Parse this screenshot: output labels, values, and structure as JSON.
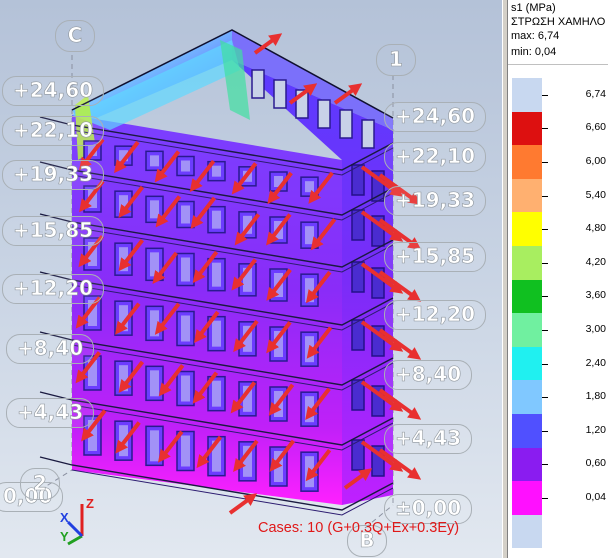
{
  "viewport": {
    "levels": [
      "+24,60",
      "+22,10",
      "+19,33",
      "+15,85",
      "+12,20",
      "+8,40",
      "+4,43",
      "±0,00"
    ],
    "left_levels": [
      "+24,60",
      "+22,10",
      "+19,33",
      "+15,85",
      "+12,20",
      "+8,40",
      "+4,43",
      "0,00"
    ],
    "grid_axes": {
      "c": "C",
      "one": "1",
      "two": "2",
      "b": "B"
    },
    "cases_label": "Cases: 10 (G+0.3Q+Ex+0.3Ey)",
    "triad": {
      "x": "X",
      "y": "Y",
      "z": "Z"
    }
  },
  "legend": {
    "quantity": "s1 (MPa)",
    "layer": "ΣΤΡΩΣΗ ΧΑΜΗΛΟ",
    "max_label": "max: 6,74",
    "min_label": "min: 0,04",
    "scale": [
      {
        "value": "6,74",
        "color": "#c8d8f0"
      },
      {
        "value": "6,60",
        "color": "#dd1010"
      },
      {
        "value": "6,00",
        "color": "#ff7a30"
      },
      {
        "value": "5,40",
        "color": "#ffb070"
      },
      {
        "value": "4,80",
        "color": "#ffff00"
      },
      {
        "value": "4,20",
        "color": "#a8ee60"
      },
      {
        "value": "3,60",
        "color": "#10c020"
      },
      {
        "value": "3,00",
        "color": "#70f0a0"
      },
      {
        "value": "2,40",
        "color": "#20f0f0"
      },
      {
        "value": "1,80",
        "color": "#80c8ff"
      },
      {
        "value": "1,20",
        "color": "#5050ff"
      },
      {
        "value": "0,60",
        "color": "#8a1cf0"
      },
      {
        "value": "0,04",
        "color": "#ff10ff"
      },
      {
        "value": "",
        "color": "#c8d8f0"
      }
    ]
  }
}
